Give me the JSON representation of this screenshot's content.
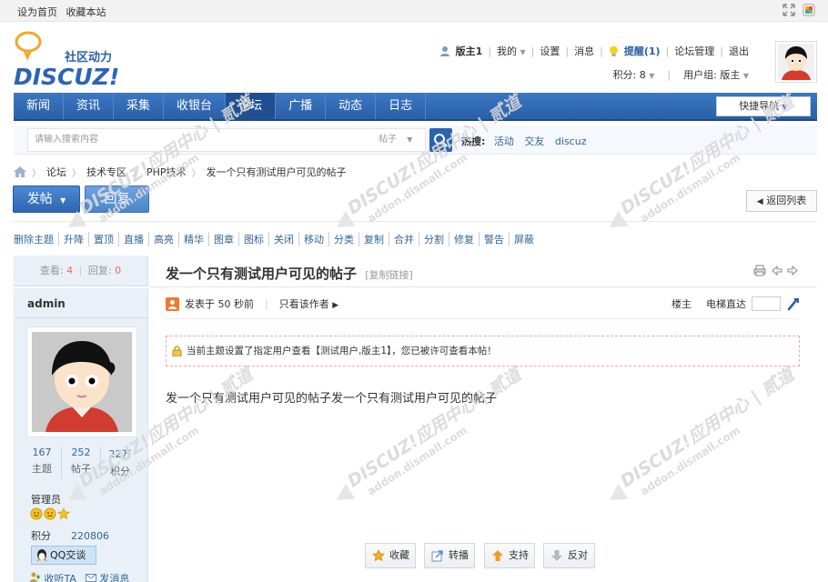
{
  "topbar": {
    "set_home": "设为首页",
    "bookmark": "收藏本站"
  },
  "logo": {
    "tagline": "社区动力",
    "brand": "DISCUZ!"
  },
  "user": {
    "name": "版主1",
    "mine": "我的",
    "settings": "设置",
    "messages": "消息",
    "reminders": "提醒(1)",
    "forum_admin": "论坛管理",
    "logout": "退出",
    "points_label": "积分: 8",
    "group_label": "用户组: 版主"
  },
  "nav": {
    "items": [
      "新闻",
      "资讯",
      "采集",
      "收银台",
      "论坛",
      "广播",
      "动态",
      "日志"
    ],
    "active_index": 4,
    "quick_nav": "快捷导航"
  },
  "search": {
    "placeholder": "请输入搜索内容",
    "scope": "帖子",
    "hot_label": "热搜:",
    "hot_keywords": [
      "活动",
      "交友",
      "discuz"
    ]
  },
  "breadcrumb": [
    "论坛",
    "技术专区",
    "PHP技术",
    "发一个只有测试用户可见的帖子"
  ],
  "buttons": {
    "post": "发帖",
    "reply": "回复",
    "back_to_list": "返回列表"
  },
  "mod_actions": [
    "删除主题",
    "升降",
    "置顶",
    "直播",
    "高亮",
    "精华",
    "图章",
    "图标",
    "关闭",
    "移动",
    "分类",
    "复制",
    "合并",
    "分割",
    "修复",
    "警告",
    "屏蔽"
  ],
  "thread_stats": {
    "views_label": "查看:",
    "views": "4",
    "replies_label": "回复:",
    "replies": "0"
  },
  "author": {
    "name": "admin",
    "stats": [
      {
        "value": "167",
        "label": "主题"
      },
      {
        "value": "252",
        "label": "帖子"
      },
      {
        "value": "22万",
        "label": "积分"
      }
    ],
    "group": "管理员",
    "points_label": "积分",
    "points": "220806",
    "qq": "QQ交谈",
    "follow": "收听TA",
    "message": "发消息"
  },
  "post": {
    "title": "发一个只有测试用户可见的帖子",
    "copy_link": "[复制链接]",
    "posted": "发表于 50 秒前",
    "only_author": "只看该作者",
    "floor": "楼主",
    "elevator": "电梯直达",
    "notice": "当前主题设置了指定用户查看【测试用户,版主1】，您已被许可查看本帖！",
    "content": "发一个只有测试用户可见的帖子发一个只有测试用户可见的帖子"
  },
  "actions": {
    "favorite": "收藏",
    "share": "转播",
    "support": "支持",
    "oppose": "反对"
  },
  "watermark": {
    "text_cn": "DISCUZ!应用中心 | 贰道",
    "text_url": "addon.dismall.com"
  },
  "colors": {
    "nav_blue": "#2b5fa8",
    "link_blue": "#336699",
    "count_red": "#f26c4f",
    "sidebar_bg": "#e9f0f8"
  }
}
